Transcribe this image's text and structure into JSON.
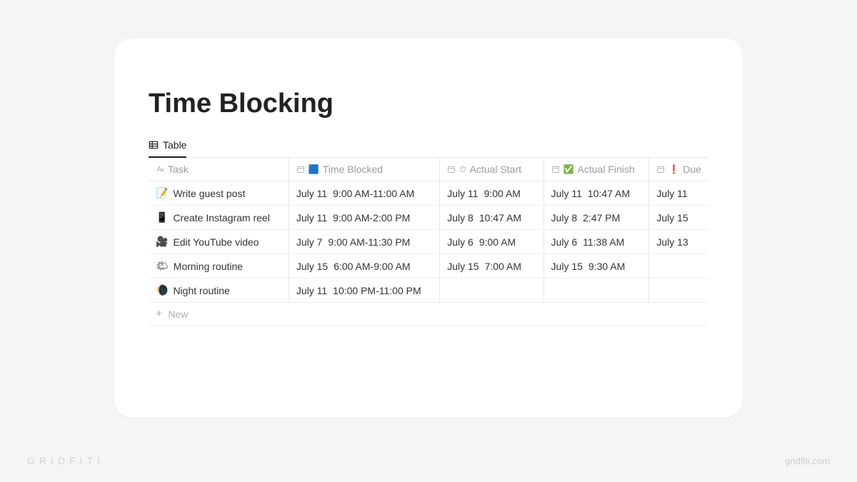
{
  "page": {
    "title": "Time Blocking"
  },
  "tabs": {
    "table": "Table"
  },
  "columns": {
    "task": "Task",
    "time_blocked_emoji": "🟦",
    "time_blocked": "Time Blocked",
    "actual_start_emoji": "⏱",
    "actual_start": "Actual Start",
    "actual_finish_emoji": "✅",
    "actual_finish": "Actual Finish",
    "due_emoji": "❗",
    "due": "Due"
  },
  "rows": [
    {
      "emoji": "📝",
      "task": "Write guest post",
      "blocked_date": "July 11",
      "blocked_time": "9:00 AM-11:00 AM",
      "start_date": "July 11",
      "start_time": "9:00 AM",
      "finish_date": "July 11",
      "finish_time": "10:47 AM",
      "due": "July 11"
    },
    {
      "emoji": "📱",
      "task": "Create Instagram reel",
      "blocked_date": "July 11",
      "blocked_time": "9:00 AM-2:00 PM",
      "start_date": "July 8",
      "start_time": "10:47 AM",
      "finish_date": "July 8",
      "finish_time": "2:47 PM",
      "due": "July 15"
    },
    {
      "emoji": "🎥",
      "task": "Edit YouTube video",
      "blocked_date": "July 7",
      "blocked_time": "9:00 AM-11:30 PM",
      "start_date": "July 6",
      "start_time": "9:00 AM",
      "finish_date": "July 6",
      "finish_time": "11:38 AM",
      "due": "July 13"
    },
    {
      "emoji": "🌤",
      "task": "Morning routine",
      "blocked_date": "July 15",
      "blocked_time": "6:00 AM-9:00 AM",
      "start_date": "July 15",
      "start_time": "7:00 AM",
      "finish_date": "July 15",
      "finish_time": "9:30 AM",
      "due": ""
    },
    {
      "emoji": "🌘",
      "task": "Night routine",
      "blocked_date": "July 11",
      "blocked_time": "10:00 PM-11:00 PM",
      "start_date": "",
      "start_time": "",
      "finish_date": "",
      "finish_time": "",
      "due": ""
    }
  ],
  "new_row": "New",
  "watermark": {
    "left": "GRIDFITI",
    "right": "gridfiti.com"
  }
}
